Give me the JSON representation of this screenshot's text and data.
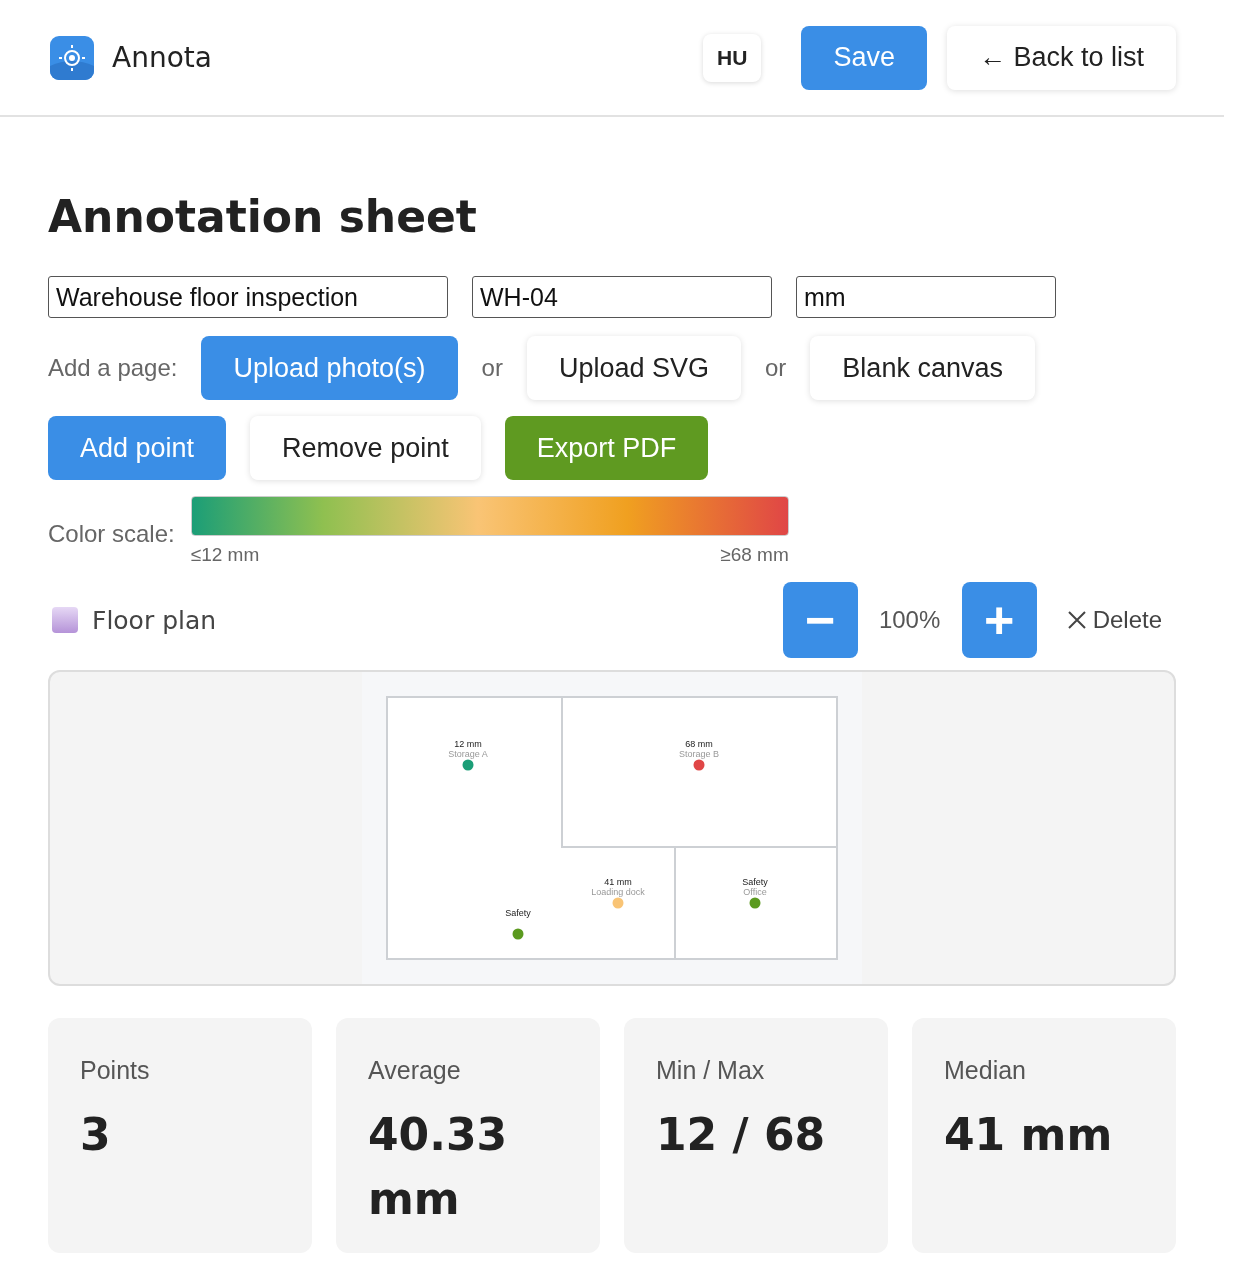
{
  "header": {
    "app_name": "Annota",
    "language": "HU",
    "save": "Save",
    "back": "← Back to list"
  },
  "title": "Annotation sheet",
  "fields": [
    {
      "value": "Warehouse floor inspection"
    },
    {
      "value": "WH-04"
    },
    {
      "value": "mm"
    }
  ],
  "add_page": {
    "label": "Add a page:",
    "items": [
      {
        "kind": "primary",
        "label": "Upload photo(s)"
      },
      {
        "kind": "separator",
        "label": "or"
      },
      {
        "kind": "secondary",
        "label": "Upload SVG"
      },
      {
        "kind": "separator",
        "label": "or"
      },
      {
        "kind": "secondary",
        "label": "Blank canvas"
      }
    ]
  },
  "actions": [
    {
      "label": "Add point",
      "kind": "primary"
    },
    {
      "label": "Remove point",
      "kind": "secondary"
    },
    {
      "label": "Export PDF",
      "kind": "success"
    }
  ],
  "color_scale": {
    "label": "Color scale:",
    "min_label": "≤12 mm",
    "max_label": "≥68 mm"
  },
  "page": {
    "title": "Floor plan",
    "zoom_out": "−",
    "zoom": "100%",
    "zoom_in": "+",
    "delete": "Delete"
  },
  "points": [
    {
      "value": "12 mm",
      "label": "Storage A",
      "color": "#1b9e77"
    },
    {
      "value": "68 mm",
      "label": "Storage B",
      "color": "#e04646"
    },
    {
      "value": "41 mm",
      "label": "Loading dock",
      "color": "#f9c475"
    },
    {
      "value": "Safety",
      "label": "Office",
      "color": "#5b9a1f"
    },
    {
      "value": "Safety",
      "color": "#5b9a1f"
    }
  ],
  "stats": [
    {
      "label": "Points",
      "value": "3"
    },
    {
      "label": "Average",
      "value": "40.33 mm"
    },
    {
      "label": "Min / Max",
      "value": "12 / 68"
    },
    {
      "label": "Median",
      "value": "41 mm"
    }
  ]
}
